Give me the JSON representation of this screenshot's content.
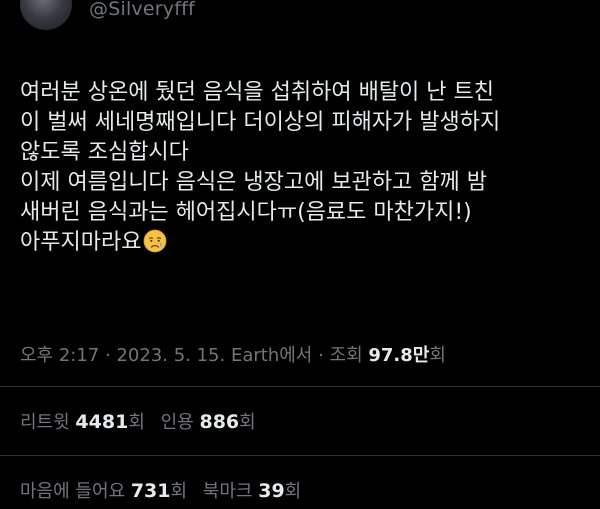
{
  "author": {
    "handle": "@Silveryfff"
  },
  "tweet": {
    "lines": [
      "여러분 상온에 뒀던 음식을 섭취하여 배탈이 난 트친",
      "이 벌써 세네명째입니다 더이상의 피해자가 발생하지",
      "않도록 조심합시다",
      "이제 여름입니다 음식은 냉장고에 보관하고 함께 밤",
      "새버린 음식과는 헤어집시다ㅠ(음료도 마찬가지!)",
      "아푸지마라요"
    ],
    "emoji": "crying-face"
  },
  "meta": {
    "time": "오후 2:17",
    "sep1": " · ",
    "date": "2023. 5. 15.",
    "source": "Earth에서",
    "sep2": " · ",
    "views_label": "조회",
    "views_count": "97.8만",
    "views_suffix": "회"
  },
  "stats": {
    "retweets_label": "리트윗",
    "retweets_count": "4481",
    "retweets_suffix": "회",
    "quotes_label": "인용",
    "quotes_count": "886",
    "quotes_suffix": "회",
    "likes_label": "마음에 들어요",
    "likes_count": "731",
    "likes_suffix": "회",
    "bookmarks_label": "북마크",
    "bookmarks_count": "39",
    "bookmarks_suffix": "회"
  },
  "colors": {
    "background": "#000000",
    "text": "#e7e9ea",
    "secondary": "#71767b",
    "divider": "#2f3336"
  }
}
